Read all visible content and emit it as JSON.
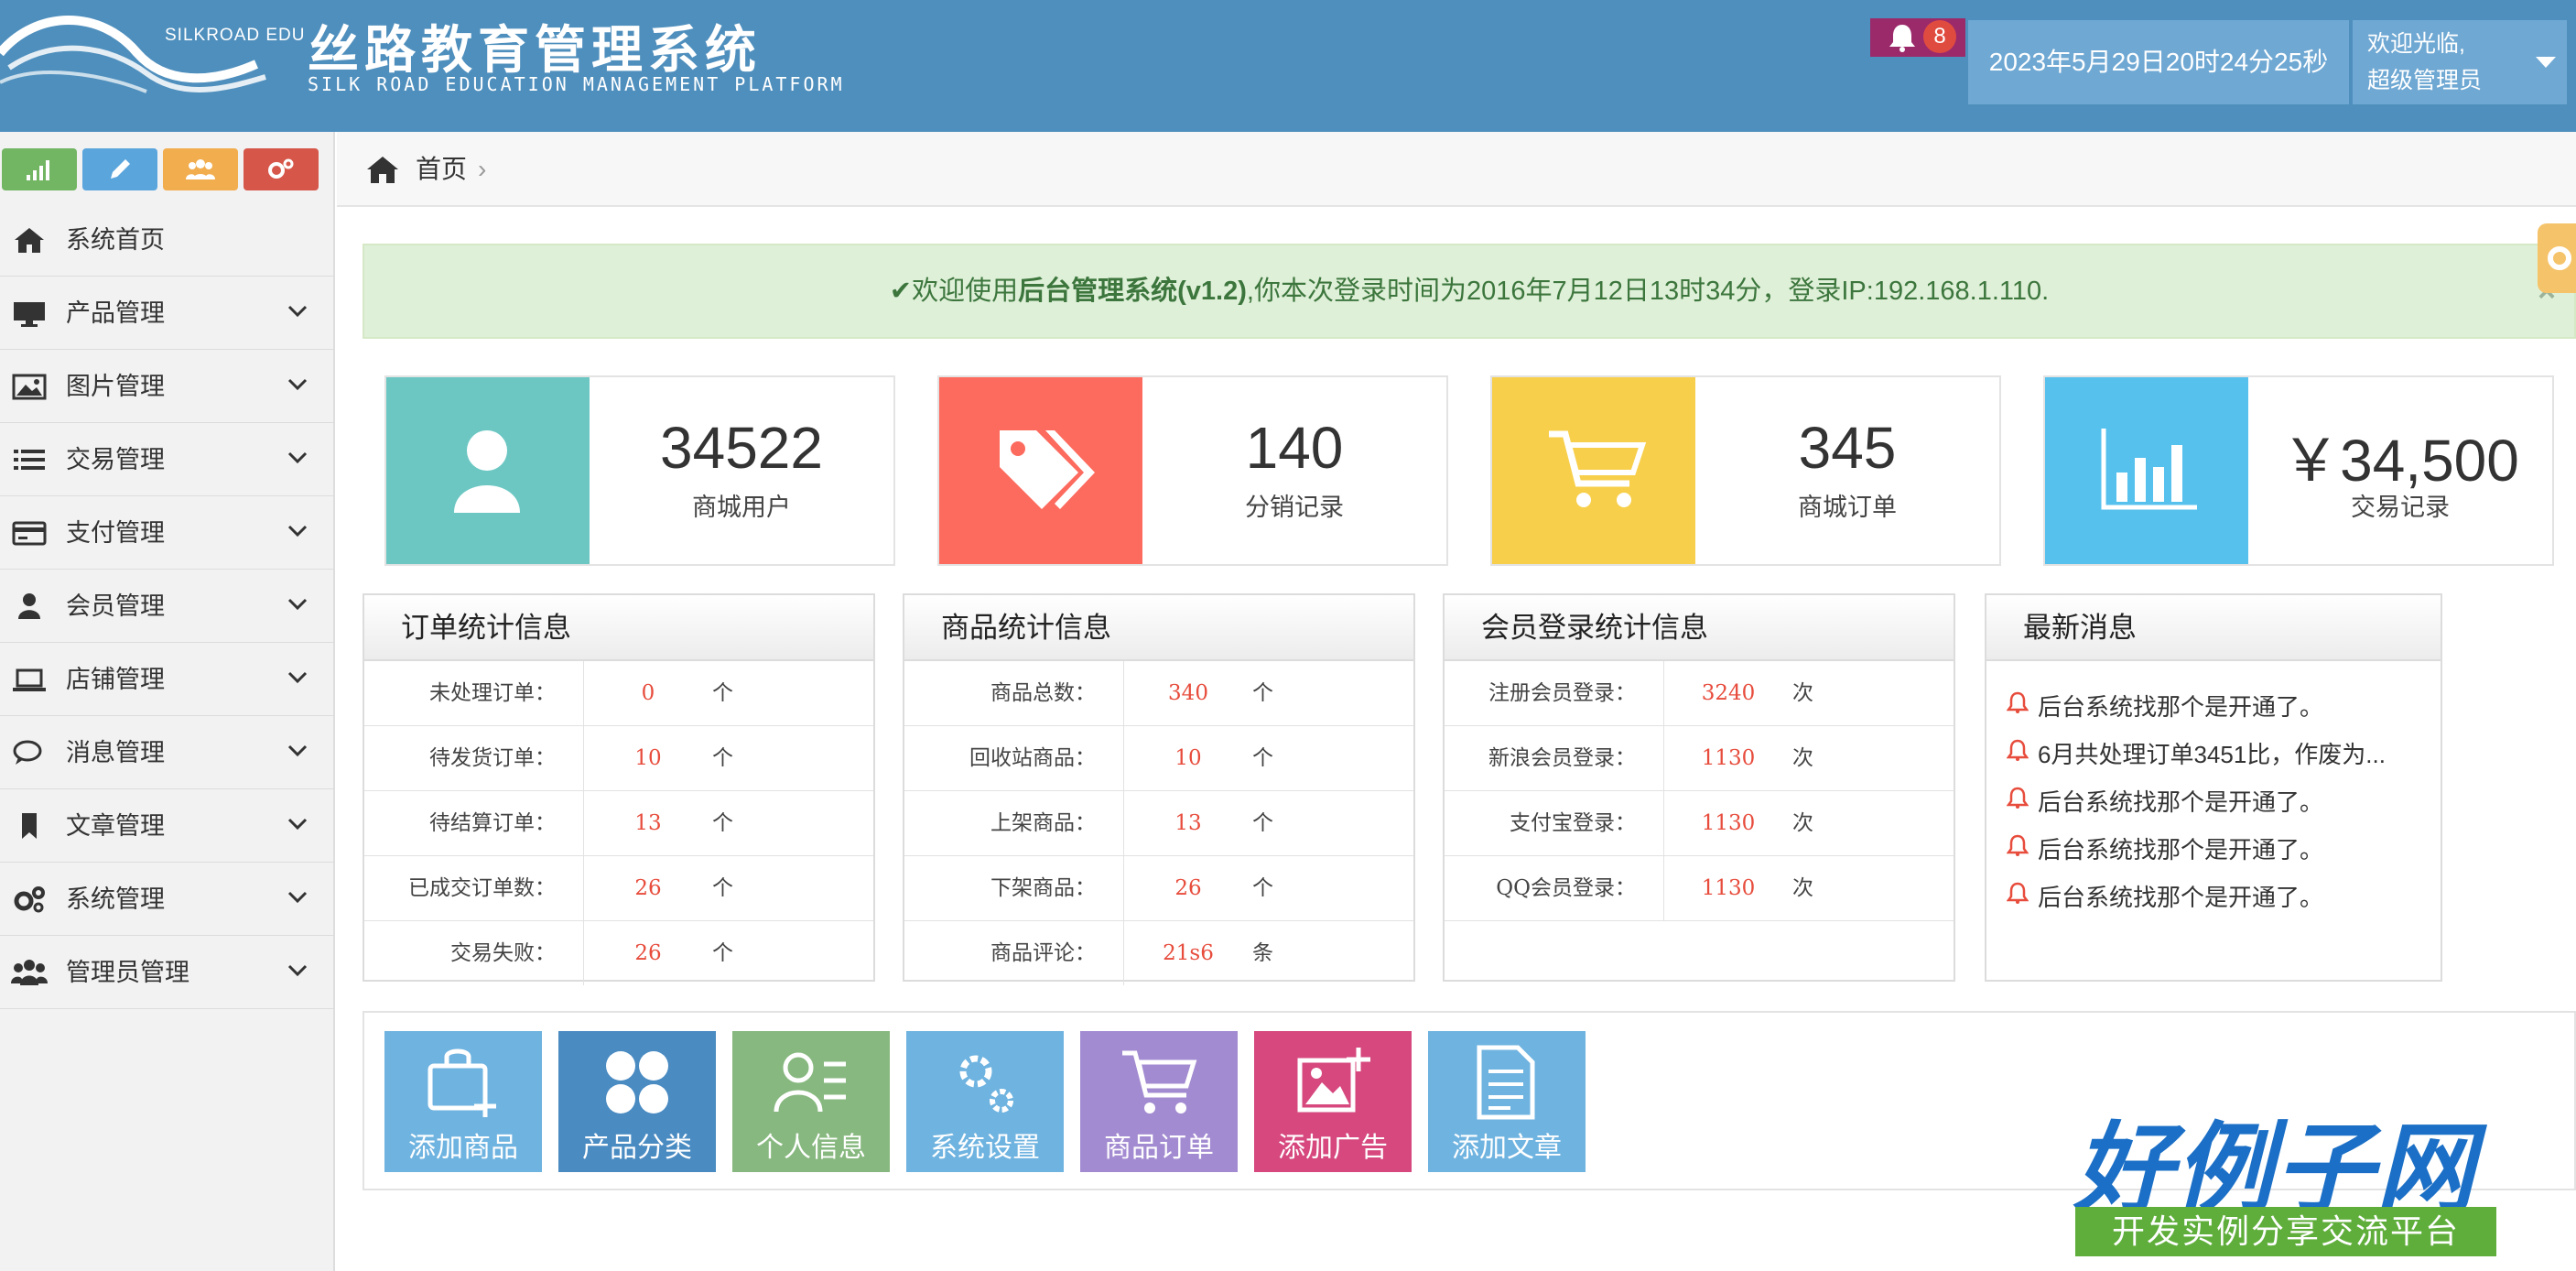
{
  "header": {
    "brand_small": "SILKROAD EDU",
    "brand_title": "丝路教育管理系统",
    "brand_subtitle": "SILK ROAD EDUCATION MANAGEMENT PLATFORM",
    "notification_count": "8",
    "datetime": "2023年5月29日20时24分25秒",
    "welcome_line1": "欢迎光临,",
    "welcome_line2": "超级管理员"
  },
  "sidebar": {
    "shortcuts": [
      {
        "icon": "signal-icon",
        "color": "#72b563"
      },
      {
        "icon": "pencil-icon",
        "color": "#5ba5dd"
      },
      {
        "icon": "users-icon",
        "color": "#f1ad4e"
      },
      {
        "icon": "cogs-icon",
        "color": "#d6574a"
      }
    ],
    "items": [
      {
        "label": "系统首页",
        "icon": "home-icon",
        "expandable": false
      },
      {
        "label": "产品管理",
        "icon": "monitor-icon",
        "expandable": true
      },
      {
        "label": "图片管理",
        "icon": "picture-icon",
        "expandable": true
      },
      {
        "label": "交易管理",
        "icon": "list-icon",
        "expandable": true
      },
      {
        "label": "支付管理",
        "icon": "credit-card-icon",
        "expandable": true
      },
      {
        "label": "会员管理",
        "icon": "user-icon",
        "expandable": true
      },
      {
        "label": "店铺管理",
        "icon": "laptop-icon",
        "expandable": true
      },
      {
        "label": "消息管理",
        "icon": "comments-icon",
        "expandable": true
      },
      {
        "label": "文章管理",
        "icon": "bookmark-icon",
        "expandable": true
      },
      {
        "label": "系统管理",
        "icon": "cogs-icon",
        "expandable": true
      },
      {
        "label": "管理员管理",
        "icon": "group-icon",
        "expandable": true
      }
    ]
  },
  "breadcrumb": {
    "home": "首页",
    "separator": "›"
  },
  "alert": {
    "prefix": "欢迎使用",
    "strong": "后台管理系统",
    "version": "(v1.2)",
    "rest": ",你本次登录时间为2016年7月12日13时34分，登录IP:192.168.1.110.",
    "close": "×"
  },
  "stats": [
    {
      "value": "34522",
      "label": "商城用户",
      "icon": "user-icon",
      "color": "#6cc7c3"
    },
    {
      "value": "140",
      "label": "分销记录",
      "icon": "tags-icon",
      "color": "#fd6a5e"
    },
    {
      "value": "345",
      "label": "商城订单",
      "icon": "cart-icon",
      "color": "#f7cf4b"
    },
    {
      "value": "￥34,500",
      "label": "交易记录",
      "icon": "bar-chart-icon",
      "color": "#57c1ee"
    }
  ],
  "panels": [
    {
      "title": "订单统计信息",
      "rows": [
        {
          "label": "未处理订单：",
          "value": "0",
          "unit": "个"
        },
        {
          "label": "待发货订单：",
          "value": "10",
          "unit": "个"
        },
        {
          "label": "待结算订单：",
          "value": "13",
          "unit": "个"
        },
        {
          "label": "已成交订单数：",
          "value": "26",
          "unit": "个"
        },
        {
          "label": "交易失败：",
          "value": "26",
          "unit": "个"
        }
      ]
    },
    {
      "title": "商品统计信息",
      "rows": [
        {
          "label": "商品总数：",
          "value": "340",
          "unit": "个"
        },
        {
          "label": "回收站商品：",
          "value": "10",
          "unit": "个"
        },
        {
          "label": "上架商品：",
          "value": "13",
          "unit": "个"
        },
        {
          "label": "下架商品：",
          "value": "26",
          "unit": "个"
        },
        {
          "label": "商品评论：",
          "value": "21s6",
          "unit": "条"
        }
      ]
    },
    {
      "title": "会员登录统计信息",
      "rows": [
        {
          "label": "注册会员登录：",
          "value": "3240",
          "unit": "次"
        },
        {
          "label": "新浪会员登录：",
          "value": "1130",
          "unit": "次"
        },
        {
          "label": "支付宝登录：",
          "value": "1130",
          "unit": "次"
        },
        {
          "label": "QQ会员登录：",
          "value": "1130",
          "unit": "次"
        }
      ]
    }
  ],
  "news": {
    "title": "最新消息",
    "items": [
      "后台系统找那个是开通了。",
      "6月共处理订单3451比，作废为...",
      "后台系统找那个是开通了。",
      "后台系统找那个是开通了。",
      "后台系统找那个是开通了。"
    ]
  },
  "quick_actions": [
    {
      "label": "添加商品",
      "icon": "bag-add-icon",
      "color": "#6fb3e0"
    },
    {
      "label": "产品分类",
      "icon": "category-icon",
      "color": "#4a8bc2"
    },
    {
      "label": "个人信息",
      "icon": "user-info-icon",
      "color": "#87b87f"
    },
    {
      "label": "系统设置",
      "icon": "settings-icon",
      "color": "#6fb3e0"
    },
    {
      "label": "商品订单",
      "icon": "cart-icon",
      "color": "#a38bd1"
    },
    {
      "label": "添加广告",
      "icon": "image-add-icon",
      "color": "#d6487e"
    },
    {
      "label": "添加文章",
      "icon": "document-icon",
      "color": "#6fb3e0"
    }
  ],
  "watermark": {
    "title": "好例子网",
    "subtitle": "开发实例分享交流平台"
  }
}
